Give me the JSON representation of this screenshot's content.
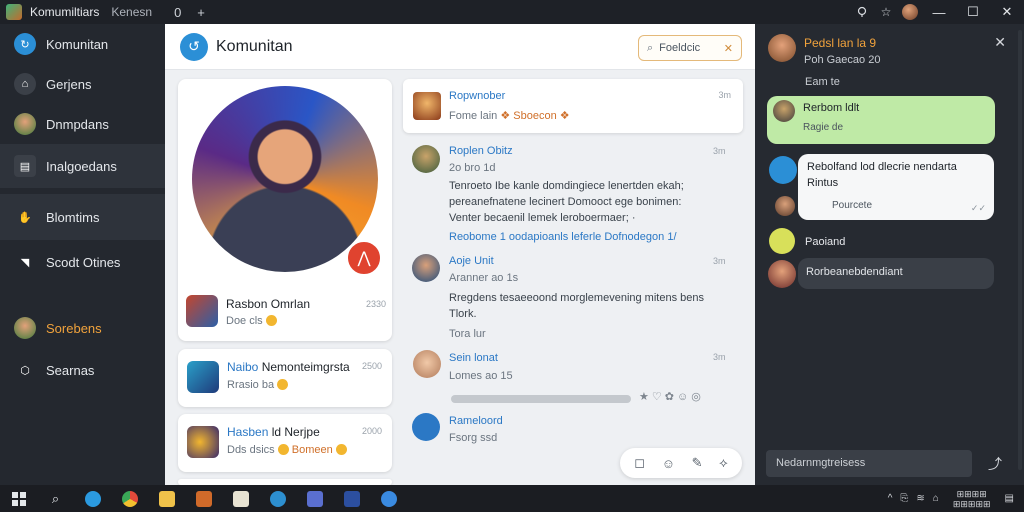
{
  "titlebar": {
    "app_name": "Komumiltiars",
    "window_subtitle": "Kenesn",
    "tab_glyph": "0",
    "new_tab": "+",
    "icons": [
      "bulb-icon",
      "star-icon",
      "user-avatar",
      "minimize-icon",
      "maximize-icon",
      "close-icon"
    ],
    "minimize": "—",
    "maximize": "☐",
    "close": "✕"
  },
  "sidebar": {
    "items": [
      {
        "label": "Komunitan",
        "icon": "community-icon",
        "color": "#2b8fd6"
      },
      {
        "label": "Gerjens",
        "icon": "home-icon"
      },
      {
        "label": "Dnmpdans",
        "icon": "avatar-icon"
      },
      {
        "label": "Inalgoedans",
        "icon": "group-icon"
      },
      {
        "label": "Blomtims",
        "icon": "hand-icon"
      },
      {
        "label": "Scodt Otines",
        "icon": "tag-icon"
      },
      {
        "label": "Sorebens",
        "icon": "avatar-icon",
        "color": "#f0a23c"
      },
      {
        "label": "Searnas",
        "icon": "hex-icon"
      }
    ]
  },
  "center": {
    "title": "Komunitan",
    "search_label": "Foeldcic",
    "profile": {
      "name": "Rasbon Omrlan",
      "sub": "Doe cls",
      "time": "2330"
    },
    "list": [
      {
        "name_prefix": "Naibo",
        "name_rest": "Nemonteimgrsta",
        "sub": "Rrasio ba",
        "time": "2500"
      },
      {
        "name_prefix": "Hasben",
        "name_rest": "ld Nerjpe",
        "sub": "Dds dsics",
        "sub_link": "Bomeen",
        "time": "2000"
      }
    ],
    "feed_top": {
      "name": "Ropwnober",
      "sub": "Fome lain",
      "tag": "Sboecon",
      "time": "3m"
    },
    "posts": [
      {
        "name": "Roplen Obitz",
        "sub": "2o bro 1d",
        "time": "3m",
        "body": [
          "Tenroeto Ibe kanle domdingiece lenertden ekah;",
          "pereanefnatene lecinert Domooct ege bonimen:",
          "Venter becaenil lemek leroboermaer; ·"
        ],
        "footer": "Reobome 1 oodapioanls leferle Dofnodegon 1/"
      },
      {
        "name": "Aoje Unit",
        "sub": "Aranner ao 1s",
        "time": "3m",
        "body": [
          "Rregdens tesaeeoond morglemevening mitens bens",
          "Tlork."
        ],
        "footer": "Tora lur"
      },
      {
        "name": "Sein lonat",
        "sub": "Lomes ao 15",
        "time": "3m"
      },
      {
        "name": "Rameloord",
        "sub": "Fsorg ssd",
        "time": ""
      }
    ],
    "post_actions": [
      "★",
      "♡",
      "✿",
      "☺",
      "◎"
    ],
    "toolbar_icons": [
      "◻",
      "☺",
      "✎",
      "⟡"
    ]
  },
  "chat": {
    "header": {
      "name": "Pedsl lan la 9",
      "status": "Poh Gaecao 20",
      "time": "Eam te"
    },
    "messages": [
      {
        "title": "Rerbom ldlt",
        "sub": "Ragie de",
        "style": "green"
      },
      {
        "lines": [
          "Rebolfand lod dlecrie nendarta",
          "Rintus"
        ],
        "meta_name": "Pourcete",
        "style": "white"
      },
      {
        "title": "Paoiand",
        "style": "plain"
      },
      {
        "title": "Rorbeanebdendiant",
        "style": "dark"
      }
    ],
    "input_placeholder": "Nedarnmgtreisess",
    "send_icon": "send-icon"
  },
  "taskbar": {
    "icons": [
      "windows-icon",
      "search-icon",
      "edge-icon",
      "chrome-icon",
      "folder-icon",
      "app-icon",
      "doc-icon",
      "globe-icon",
      "photos-icon",
      "app-icon",
      "app-icon"
    ],
    "tray_text": [
      "^",
      "⎘",
      "≋",
      "⌂"
    ],
    "clock_top": "⊞⊞⊞⊞",
    "clock_bottom": "⊞⊞⊞⊞⊞"
  }
}
